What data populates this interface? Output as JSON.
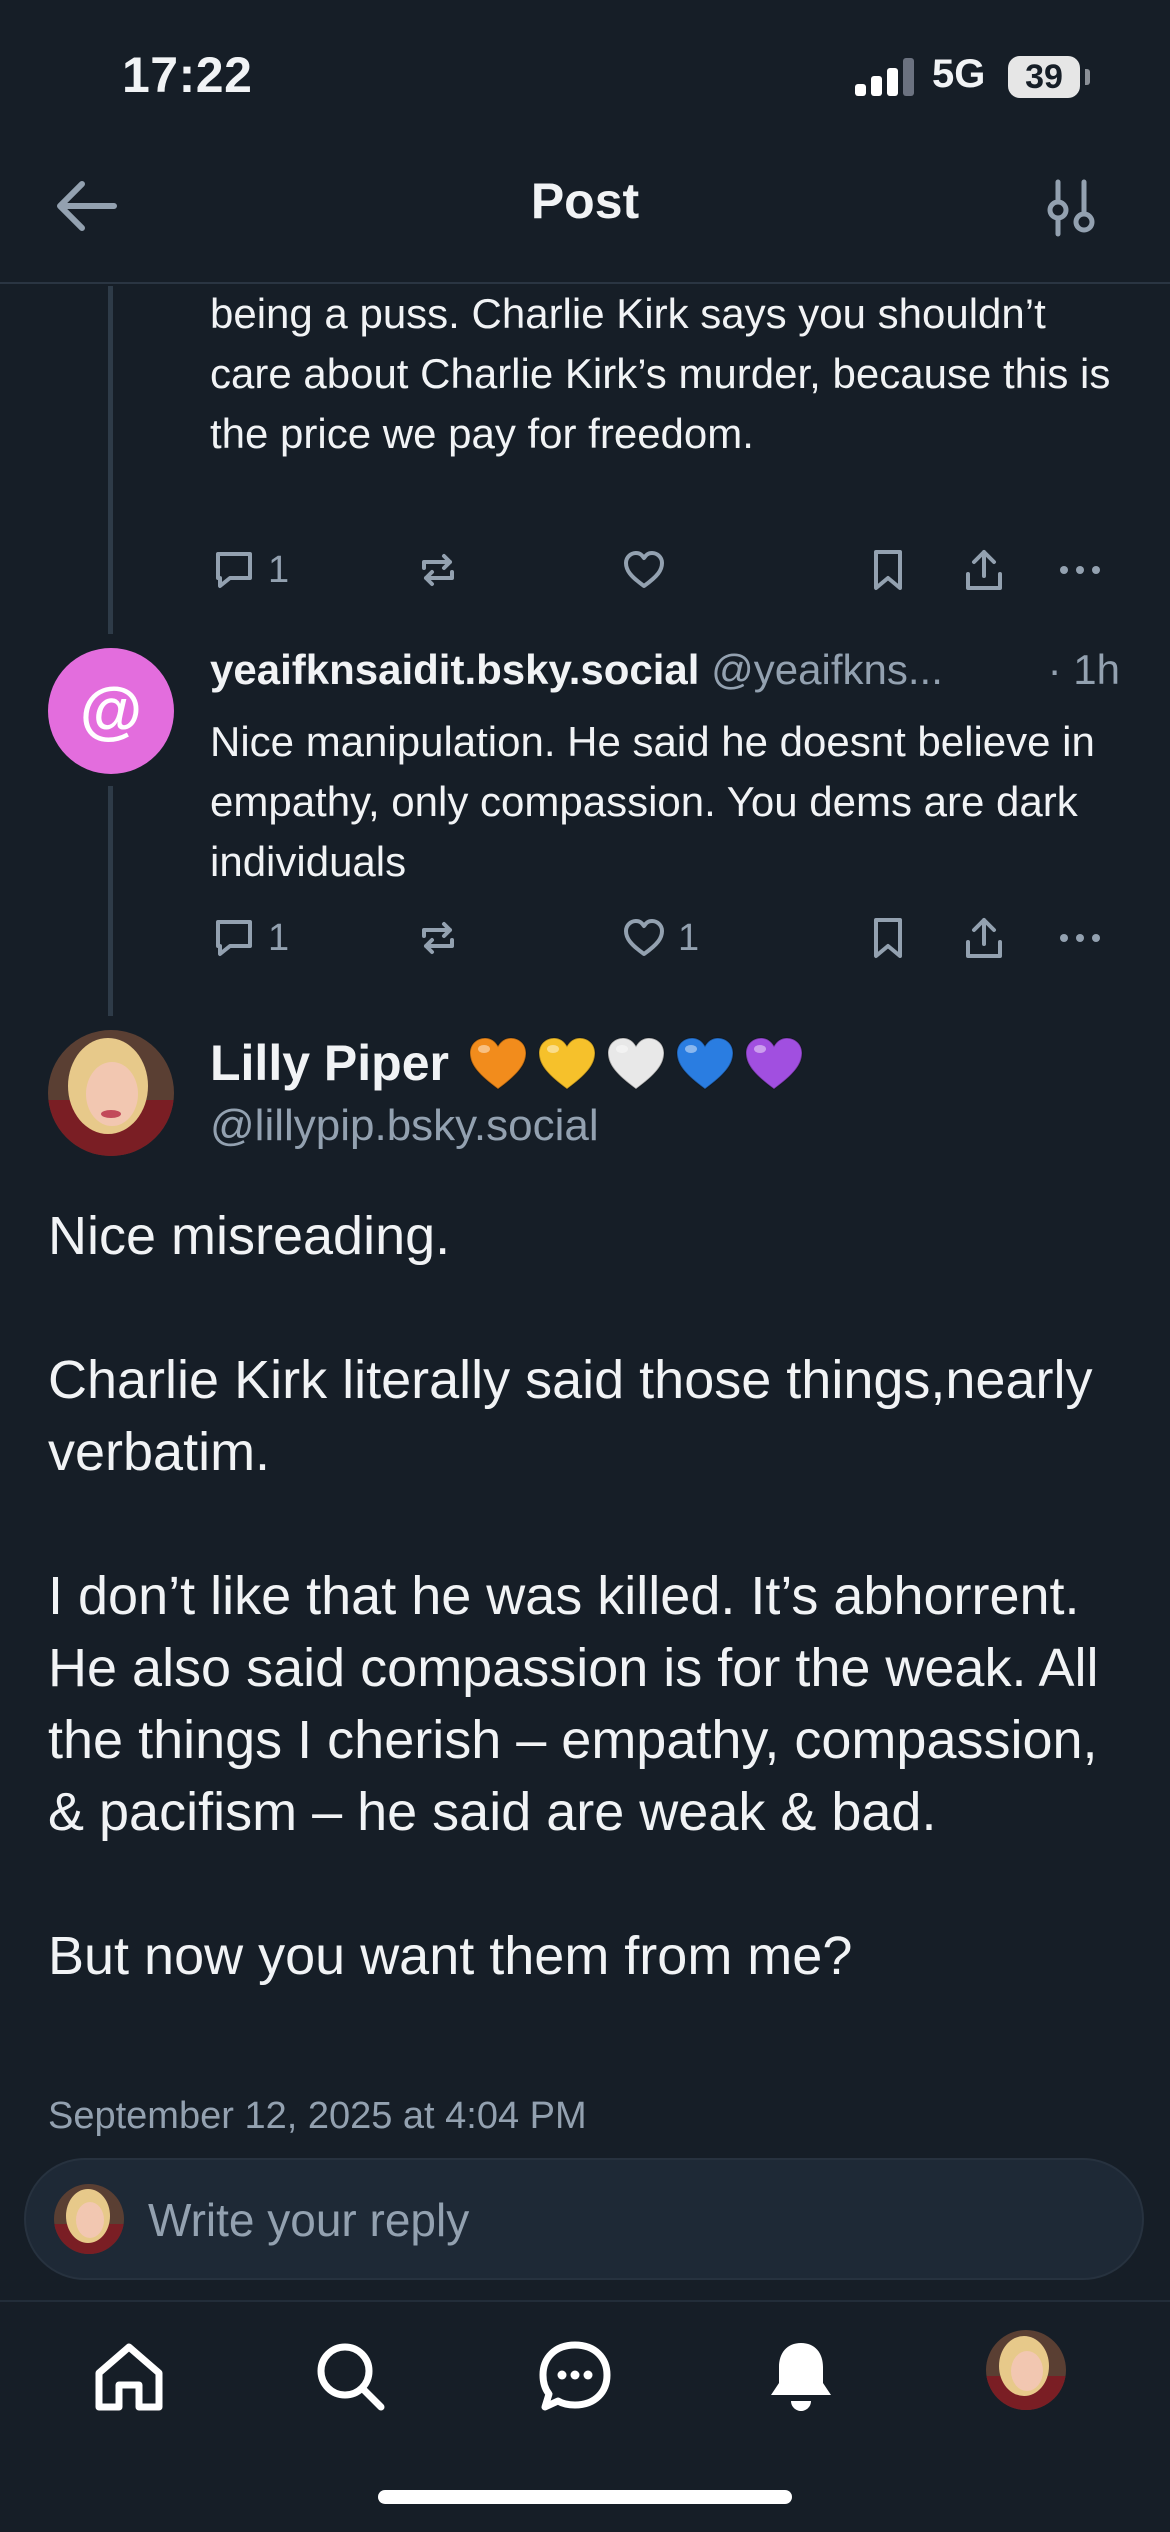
{
  "status_bar": {
    "time": "17:22",
    "network": "5G",
    "battery": "39"
  },
  "header": {
    "title": "Post"
  },
  "parent_post": {
    "text": "being a puss. Charlie Kirk says you shouldn’t care about Charlie Kirk’s murder, because this is the price we pay for freedom.",
    "actions": {
      "reply_count": "1",
      "repost_count": "",
      "like_count": ""
    }
  },
  "reply_post": {
    "author_name": "yeaifknsaidit.bsky.social",
    "author_handle": "@yeaifkns...",
    "time": "· 1h",
    "avatar_symbol": "@",
    "text": "Nice manipulation. He said he doesnt believe in empathy, only compassion. You dems are dark individuals",
    "actions": {
      "reply_count": "1",
      "repost_count": "",
      "like_count": "1"
    }
  },
  "main_post": {
    "author_name": "Lilly Piper",
    "author_handle": "@lillypip.bsky.social",
    "heart_colors": [
      "#f28c1c",
      "#f6c12b",
      "#e8e8e8",
      "#2a7de1",
      "#a14fe0"
    ],
    "paragraphs": [
      "Nice misreading.",
      "Charlie Kirk literally said those things,nearly verbatim.",
      "I don’t like that he was killed. It’s abhorrent. He also said compassion is for the weak. All the things I cherish – empathy, compassion, & pacifism – he said are weak & bad.",
      "But now you want them from me?"
    ],
    "timestamp": "September 12, 2025 at 4:04 PM"
  },
  "reply_bar": {
    "placeholder": "Write your reply"
  },
  "tab_bar": {
    "items": [
      "home-icon",
      "search-icon",
      "chat-icon",
      "notifications-icon",
      "profile-avatar"
    ]
  },
  "colors": {
    "background": "#161e27",
    "muted": "#93a1b0",
    "accent_avatar": "#e36ddd"
  }
}
